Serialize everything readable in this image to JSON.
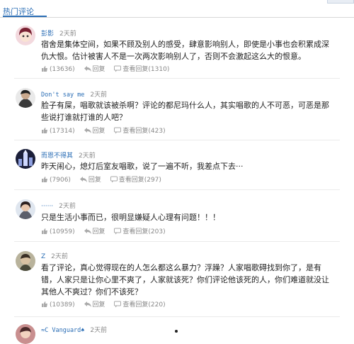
{
  "header": {
    "tab_label": "热门评论"
  },
  "comments": [
    {
      "user": "彭影",
      "time": "2天前",
      "text": "宿舍是集体空间，如果不顾及别人的感受，肆意影响别人，即使是小事也会积累成深仇大恨。估计被害人不是一次两次影响别人了，否则不会激起这么大的恨意。",
      "likes": "(13636)",
      "reply_label": "回复",
      "view_label": "查看回复(1310)"
    },
    {
      "user": "Don't say me",
      "time": "2天前",
      "text": "脸子有屎，唱歌就该被杀啊？评论的都尼玛什么人，其实唱歌的人不可恶，可恶是那些说打谁就打谁的人吧？",
      "likes": "(17314)",
      "reply_label": "回复",
      "view_label": "查看回复(423)"
    },
    {
      "user": "而恩不得其",
      "time": "2天前",
      "text": "昨天闹心，熄灯后室友唱歌，说了一遍不听，我差点下去···",
      "likes": "(7906)",
      "reply_label": "回复",
      "view_label": "查看回复(297)"
    },
    {
      "user": "······",
      "time": "2天前",
      "text": "只是生活小事而已，很明显嫌疑人心理有问题！！！",
      "likes": "(10959)",
      "reply_label": "回复",
      "view_label": "查看回复(203)"
    },
    {
      "user": "Z",
      "time": "2天前",
      "text": "看了评论，真心觉得现在的人怎么都这么暴力？浮躁？人家唱歌碍找到你了，是有错，人家只是让你心里不爽了，人家就该死？你们评论他该死的人，你们难道就没让其他人不爽过？你们不该死？",
      "likes": "(10389)",
      "reply_label": "回复",
      "view_label": "查看回复(220)"
    },
    {
      "user": "≈C Vanguard♠",
      "time": "2天前"
    }
  ]
}
